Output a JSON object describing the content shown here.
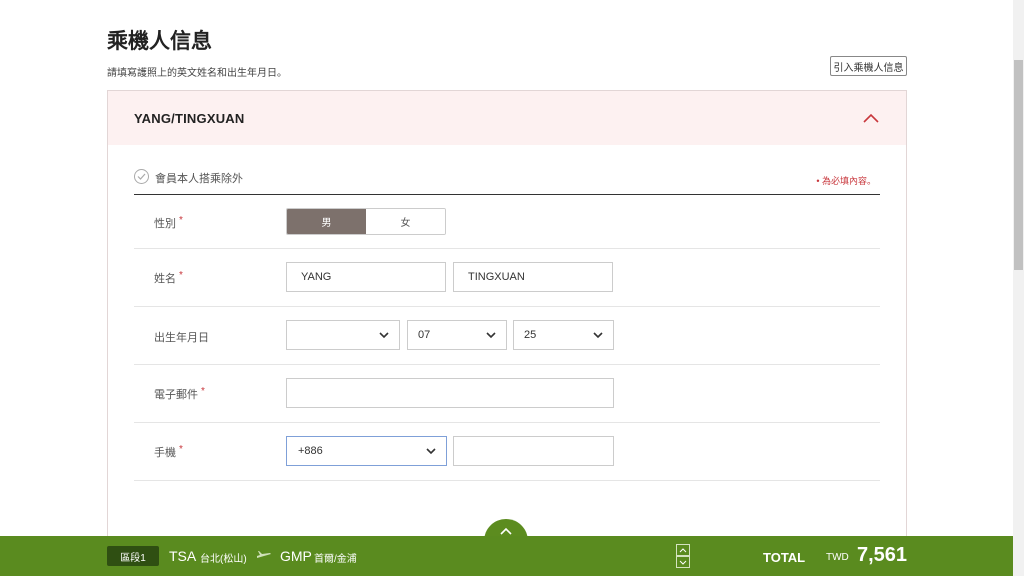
{
  "header": {
    "title": "乘機人信息",
    "subtitle": "請填寫護照上的英文姓名和出生年月日。",
    "import_button": "引入乘機人信息"
  },
  "passenger": {
    "name": "YANG/TINGXUAN",
    "exclude_member": "會員本人搭乘除外",
    "required_note": "• 為必填內容。",
    "required_mark": "*",
    "gender": {
      "label": "性別",
      "options": [
        "男",
        "女"
      ],
      "selected": "男"
    },
    "name_fields": {
      "label": "姓名",
      "last": "YANG",
      "first": "TINGXUAN"
    },
    "birth": {
      "label": "出生年月日",
      "year": "",
      "month": "07",
      "day": "25"
    },
    "email": {
      "label": "電子郵件",
      "value": ""
    },
    "phone": {
      "label": "手機",
      "country_code": "+886",
      "number": ""
    }
  },
  "bottom_bar": {
    "segment": "區段1",
    "from_code": "TSA",
    "from_city": "台北(松山)",
    "to_code": "GMP",
    "to_city": "首爾/金浦",
    "total_label": "TOTAL",
    "currency": "TWD",
    "amount": "7,561"
  },
  "colors": {
    "accent_green": "#5a8b1f",
    "required_red": "#c8373c",
    "selected_gender": "#7d716c"
  }
}
